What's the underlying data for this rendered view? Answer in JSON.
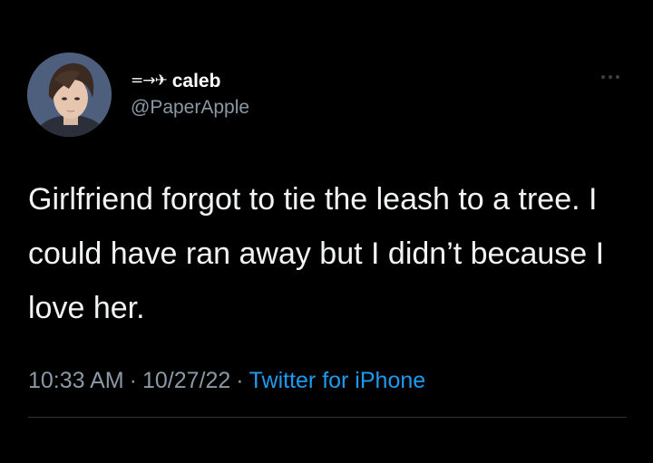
{
  "tweet": {
    "author": {
      "name_prefix_icon": "plane-icon",
      "name_prefix_glyph": "=→✈",
      "display_name": "caleb",
      "handle": "@PaperApple"
    },
    "text": "Girlfriend forgot to tie the leash to a tree. I could have ran away but I didn’t because I love her.",
    "time": "10:33 AM",
    "date": "10/27/22",
    "separator": "·",
    "source": "Twitter for iPhone"
  },
  "colors": {
    "background": "#000000",
    "text": "#f2f3f4",
    "secondary": "#8b98a5",
    "link": "#1d9bf0",
    "divider": "#2f3336"
  }
}
